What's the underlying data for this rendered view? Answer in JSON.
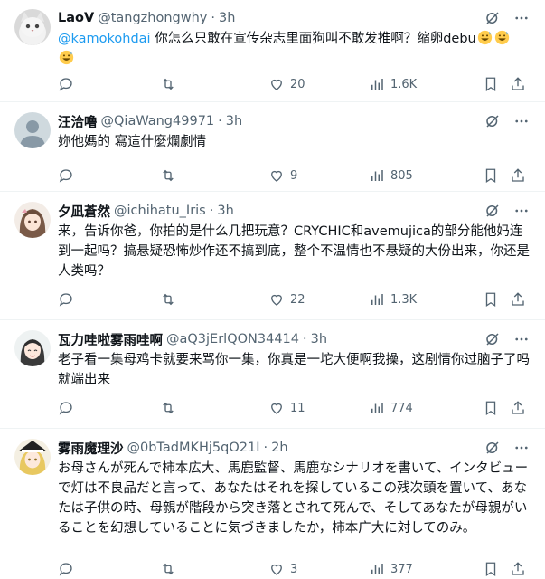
{
  "colors": {
    "text": "#0f1419",
    "secondary": "#536471",
    "accent": "#1d9bf0",
    "divider": "#eff3f4"
  },
  "tweets": [
    {
      "name": "LaoV",
      "handle": "@tangzhongwhy",
      "sep": "·",
      "time": "3h",
      "mention": "@kamokohdai",
      "text": " 你怎么只敢在宣传杂志里面狗叫不敢发推啊？缩卵debu",
      "emoji": "grinning-sweat-emoji",
      "replies": "",
      "retweets": "",
      "likes": "20",
      "views": "1.6K"
    },
    {
      "name": "汪洽噜",
      "handle": "@QiaWang49971",
      "sep": "·",
      "time": "3h",
      "text": "妳他媽的 寫這什麼爛劇情",
      "replies": "",
      "retweets": "",
      "likes": "9",
      "views": "805"
    },
    {
      "name": "夕凪蒼然",
      "handle": "@ichihatu_Iris",
      "sep": "·",
      "time": "3h",
      "text": "来，告诉你爸，你拍的是什么几把玩意？CRYCHIC和avemujica的部分能他妈连到一起吗？搞悬疑恐怖炒作还不搞到底，整个不温情也不悬疑的大份出来，你还是人类吗？",
      "replies": "",
      "retweets": "",
      "likes": "22",
      "views": "1.3K"
    },
    {
      "name": "瓦力哇啦雾雨哇啊",
      "handle": "@aQ3jErlQON34414",
      "sep": "·",
      "time": "3h",
      "text": "老子看一集母鸡卡就要来骂你一集，你真是一坨大便啊我操，这剧情你过脑子了吗就端出来",
      "replies": "",
      "retweets": "",
      "likes": "11",
      "views": "774"
    },
    {
      "name": "雾雨魔理沙",
      "handle": "@0bTadMKHj5qO21I",
      "sep": "·",
      "time": "2h",
      "text": "お母さんが死んで柿本広大、馬鹿監督、馬鹿なシナリオを書いて、インタビューで灯は不良品だと言って、あなたはそれを探しているこの残次頭を置いて、あなたは子供の時、母親が階段から突き落とされて死んで、そしてあなたが母親がいることを幻想していることに気づきましたか，柿本广大に対してのみ。",
      "replies": "",
      "retweets": "",
      "likes": "3",
      "views": "377"
    }
  ]
}
